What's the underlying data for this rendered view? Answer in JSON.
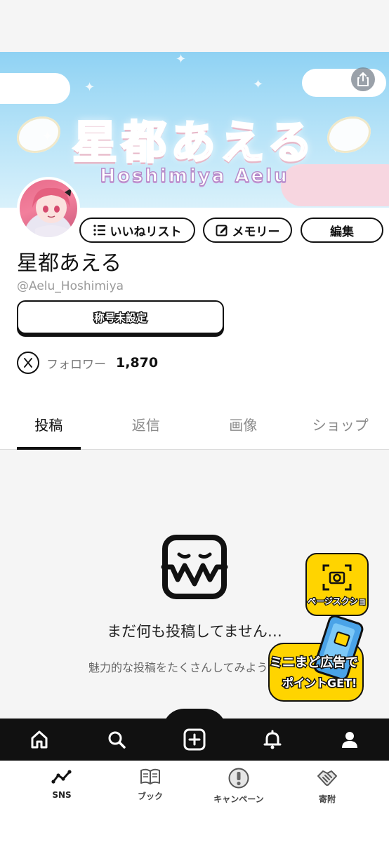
{
  "banner": {
    "title": "星都あえる",
    "subtitle": "Hoshimiya Aelu"
  },
  "icons": {
    "share": "share-icon",
    "list": "list-icon",
    "edit": "pencil-box-icon",
    "x": "x-logo-icon",
    "empty": "sad-face-box-icon",
    "camera": "camera-icon",
    "home": "home-icon",
    "search": "search-icon",
    "create": "plus-box-icon",
    "bell": "bell-icon",
    "user": "user-icon",
    "sns": "activity-icon",
    "book": "book-icon",
    "campaign": "exclamation-icon",
    "donate": "handshake-icon"
  },
  "profile": {
    "like_list_label": "いいねリスト",
    "memory_label": "メモリー",
    "edit_label": "編集",
    "name": "星都あえる",
    "handle": "@Aelu_Hoshimiya",
    "title_button_label": "称号未設定",
    "followers_label": "フォロワー",
    "followers_count": "1,870"
  },
  "tabs": [
    {
      "label": "投稿",
      "active": true
    },
    {
      "label": "返信",
      "active": false
    },
    {
      "label": "画像",
      "active": false
    },
    {
      "label": "ショップ",
      "active": false
    }
  ],
  "empty_state": {
    "title": "まだ何も投稿してません…",
    "subtitle": "魅力的な投稿をたくさんしてみよう"
  },
  "floating": {
    "screenshot_label": "ページスクショ",
    "ad_line1": "ミニまど広告で",
    "ad_line2": "ポイントGET!"
  },
  "bottom_nav": [
    {
      "label": "SNS"
    },
    {
      "label": "ブック"
    },
    {
      "label": "キャンペーン"
    },
    {
      "label": "寄附"
    }
  ],
  "colors": {
    "accent_yellow": "#ffd400",
    "banner_pink": "#f49ab8",
    "banner_sky": "#8fd2f3",
    "nav_dark": "#111111"
  }
}
